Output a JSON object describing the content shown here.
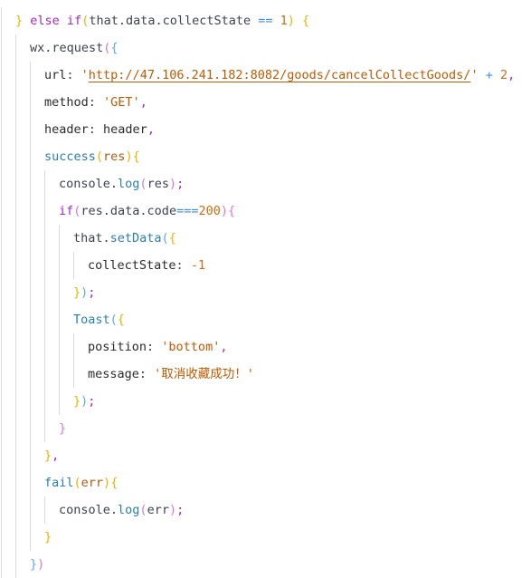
{
  "editor": {
    "language": "javascript",
    "lines": [
      {
        "indent": 1,
        "tokens": [
          {
            "t": "}",
            "c": "b1"
          },
          {
            "t": " else if",
            "c": "kw"
          },
          {
            "t": "(",
            "c": "b1"
          },
          {
            "t": "that.data.collectState",
            "c": "plain"
          },
          {
            "t": " == ",
            "c": "op"
          },
          {
            "t": "1",
            "c": "num"
          },
          {
            "t": ")",
            "c": "b1"
          },
          {
            "t": " {",
            "c": "b1"
          }
        ]
      },
      {
        "indent": 2,
        "tokens": [
          {
            "t": "wx.request",
            "c": "plain"
          },
          {
            "t": "(",
            "c": "b2"
          },
          {
            "t": "{",
            "c": "b3"
          }
        ]
      },
      {
        "indent": 3,
        "tokens": [
          {
            "t": "url",
            "c": "prop"
          },
          {
            "t": ": ",
            "c": "plain"
          },
          {
            "t": "'",
            "c": "str"
          },
          {
            "t": "http://47.106.241.182:8082/goods/cancelCollectGoods/",
            "c": "url"
          },
          {
            "t": "'",
            "c": "str"
          },
          {
            "t": " + ",
            "c": "op"
          },
          {
            "t": "2",
            "c": "num"
          },
          {
            "t": ",",
            "c": "punc"
          }
        ]
      },
      {
        "indent": 3,
        "tokens": [
          {
            "t": "method",
            "c": "prop"
          },
          {
            "t": ": ",
            "c": "plain"
          },
          {
            "t": "'GET'",
            "c": "str"
          },
          {
            "t": ",",
            "c": "punc"
          }
        ]
      },
      {
        "indent": 3,
        "tokens": [
          {
            "t": "header",
            "c": "prop"
          },
          {
            "t": ": ",
            "c": "plain"
          },
          {
            "t": "header",
            "c": "prop"
          },
          {
            "t": ",",
            "c": "punc"
          }
        ]
      },
      {
        "indent": 3,
        "tokens": [
          {
            "t": "success",
            "c": "fn"
          },
          {
            "t": "(",
            "c": "b1"
          },
          {
            "t": "res",
            "c": "param"
          },
          {
            "t": ")",
            "c": "b1"
          },
          {
            "t": "{",
            "c": "b1"
          }
        ]
      },
      {
        "indent": 4,
        "tokens": [
          {
            "t": "console.",
            "c": "plain"
          },
          {
            "t": "log",
            "c": "fn"
          },
          {
            "t": "(",
            "c": "b2"
          },
          {
            "t": "res",
            "c": "plain"
          },
          {
            "t": ")",
            "c": "b2"
          },
          {
            "t": ";",
            "c": "punc"
          }
        ]
      },
      {
        "indent": 4,
        "tokens": [
          {
            "t": "if",
            "c": "kw"
          },
          {
            "t": "(",
            "c": "b2"
          },
          {
            "t": "res.data.code",
            "c": "plain"
          },
          {
            "t": "===",
            "c": "op"
          },
          {
            "t": "200",
            "c": "num"
          },
          {
            "t": ")",
            "c": "b2"
          },
          {
            "t": "{",
            "c": "b2"
          }
        ]
      },
      {
        "indent": 5,
        "tokens": [
          {
            "t": "that.",
            "c": "plain"
          },
          {
            "t": "setData",
            "c": "fn"
          },
          {
            "t": "(",
            "c": "b3"
          },
          {
            "t": "{",
            "c": "b1"
          }
        ]
      },
      {
        "indent": 6,
        "tokens": [
          {
            "t": "collectState",
            "c": "prop"
          },
          {
            "t": ": ",
            "c": "plain"
          },
          {
            "t": "-1",
            "c": "num"
          }
        ]
      },
      {
        "indent": 5,
        "tokens": [
          {
            "t": "}",
            "c": "b1"
          },
          {
            "t": ")",
            "c": "b3"
          },
          {
            "t": ";",
            "c": "punc"
          }
        ]
      },
      {
        "indent": 5,
        "tokens": [
          {
            "t": "Toast",
            "c": "fn"
          },
          {
            "t": "(",
            "c": "b3"
          },
          {
            "t": "{",
            "c": "b1"
          }
        ]
      },
      {
        "indent": 6,
        "tokens": [
          {
            "t": "position",
            "c": "prop"
          },
          {
            "t": ": ",
            "c": "plain"
          },
          {
            "t": "'bottom'",
            "c": "str"
          },
          {
            "t": ",",
            "c": "punc"
          }
        ]
      },
      {
        "indent": 6,
        "tokens": [
          {
            "t": "message",
            "c": "prop"
          },
          {
            "t": ": ",
            "c": "plain"
          },
          {
            "t": "'取消收藏成功！'",
            "c": "str"
          }
        ]
      },
      {
        "indent": 5,
        "tokens": [
          {
            "t": "}",
            "c": "b1"
          },
          {
            "t": ")",
            "c": "b3"
          },
          {
            "t": ";",
            "c": "punc"
          }
        ]
      },
      {
        "indent": 4,
        "tokens": [
          {
            "t": "}",
            "c": "b2"
          }
        ]
      },
      {
        "indent": 3,
        "tokens": [
          {
            "t": "}",
            "c": "b1"
          },
          {
            "t": ",",
            "c": "punc"
          }
        ]
      },
      {
        "indent": 3,
        "tokens": [
          {
            "t": "fail",
            "c": "fn"
          },
          {
            "t": "(",
            "c": "b1"
          },
          {
            "t": "err",
            "c": "param"
          },
          {
            "t": ")",
            "c": "b1"
          },
          {
            "t": "{",
            "c": "b1"
          }
        ]
      },
      {
        "indent": 4,
        "tokens": [
          {
            "t": "console.",
            "c": "plain"
          },
          {
            "t": "log",
            "c": "fn"
          },
          {
            "t": "(",
            "c": "b2"
          },
          {
            "t": "err",
            "c": "plain"
          },
          {
            "t": ")",
            "c": "b2"
          },
          {
            "t": ";",
            "c": "punc"
          }
        ]
      },
      {
        "indent": 3,
        "tokens": [
          {
            "t": "}",
            "c": "b1"
          }
        ]
      },
      {
        "indent": 2,
        "tokens": [
          {
            "t": "}",
            "c": "b3"
          },
          {
            "t": ")",
            "c": "b2"
          }
        ]
      }
    ]
  }
}
